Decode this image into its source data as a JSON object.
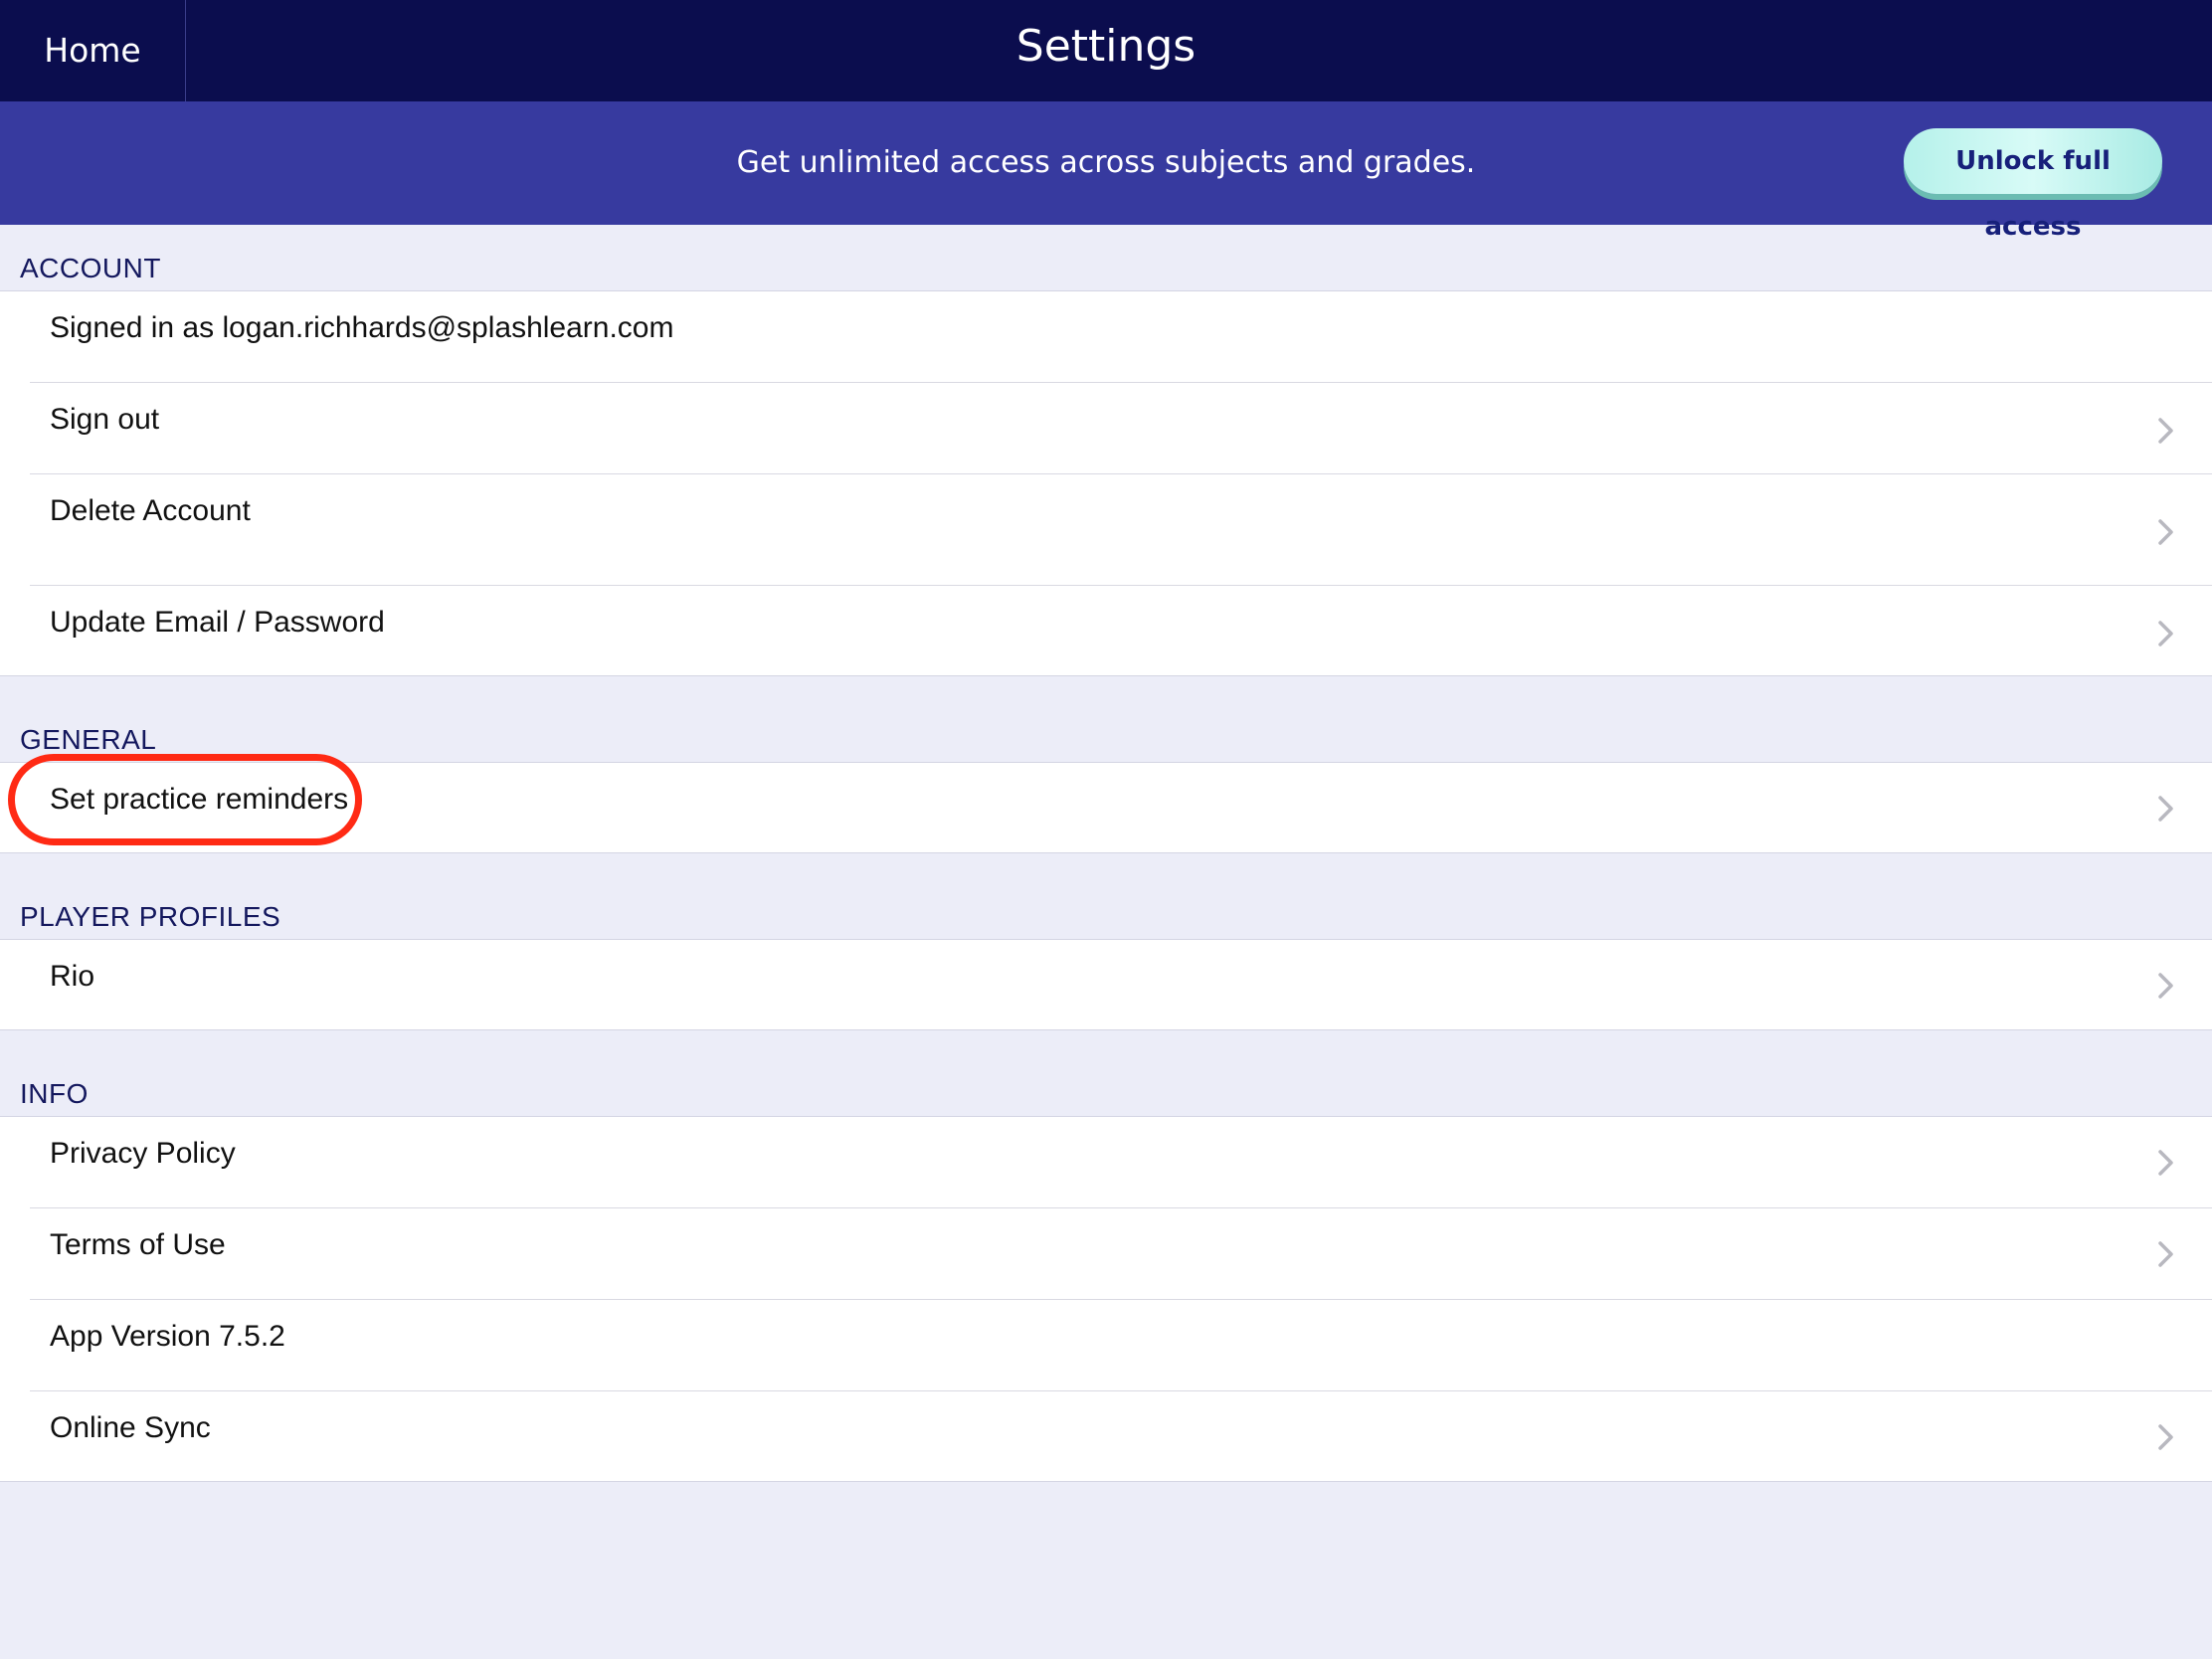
{
  "header": {
    "home_label": "Home",
    "title": "Settings"
  },
  "promo": {
    "text": "Get unlimited access across subjects and grades.",
    "button_label": "Unlock full access"
  },
  "sections": {
    "account": {
      "title": "ACCOUNT",
      "items": [
        {
          "label": "Signed in as logan.richhards@splashlearn.com",
          "chevron": false
        },
        {
          "label": "Sign out",
          "chevron": true
        },
        {
          "label": "Delete Account",
          "chevron": true
        },
        {
          "label": "Update Email / Password",
          "chevron": true
        }
      ]
    },
    "general": {
      "title": "GENERAL",
      "items": [
        {
          "label": "Set practice reminders",
          "chevron": true,
          "highlighted": true
        }
      ]
    },
    "player_profiles": {
      "title": "PLAYER PROFILES",
      "items": [
        {
          "label": "Rio",
          "chevron": true
        }
      ]
    },
    "info": {
      "title": "INFO",
      "items": [
        {
          "label": "Privacy Policy",
          "chevron": true
        },
        {
          "label": "Terms of Use",
          "chevron": true
        },
        {
          "label": "App Version 7.5.2",
          "chevron": false
        },
        {
          "label": "Online Sync",
          "chevron": true
        }
      ]
    }
  },
  "icons": {
    "chevron": "chevron-right-icon"
  },
  "colors": {
    "nav_bg": "#0b0d4e",
    "promo_bg": "#373a9f",
    "button_bg": "#b5f1ea",
    "page_bg": "#ecedf8",
    "highlight": "#ff2a14"
  }
}
